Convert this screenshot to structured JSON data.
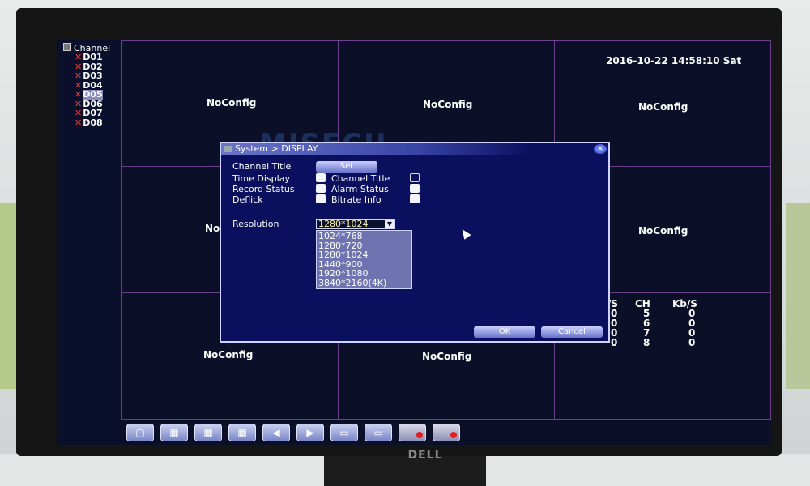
{
  "sidebar": {
    "header": "Channel",
    "items": [
      {
        "label": "D01",
        "selected": false
      },
      {
        "label": "D02",
        "selected": false
      },
      {
        "label": "D03",
        "selected": false
      },
      {
        "label": "D04",
        "selected": false
      },
      {
        "label": "D05",
        "selected": true
      },
      {
        "label": "D06",
        "selected": false
      },
      {
        "label": "D07",
        "selected": false
      },
      {
        "label": "D08",
        "selected": false
      }
    ]
  },
  "grid": {
    "noconfig_label": "NoConfig",
    "datetime": "2016-10-22 14:58:10 Sat",
    "partial_label": "No"
  },
  "stats": {
    "headers": [
      "/S",
      "CH",
      "Kb/S"
    ],
    "rows": [
      [
        "0",
        "5",
        "0"
      ],
      [
        "0",
        "6",
        "0"
      ],
      [
        "0",
        "7",
        "0"
      ],
      [
        "0",
        "8",
        "0"
      ]
    ]
  },
  "dialog": {
    "title": "System > DISPLAY",
    "close_icon": "close-icon",
    "channel_title_label": "Channel Title",
    "set_button": "Set",
    "time_display_label": "Time Display",
    "channel_title2_label": "Channel Title",
    "record_status_label": "Record Status",
    "alarm_status_label": "Alarm Status",
    "deflick_label": "Deflick",
    "bitrate_info_label": "Bitrate Info",
    "resolution_label": "Resolution",
    "resolution_value": "1280*1024",
    "resolution_options": [
      "1024*768",
      "1280*720",
      "1280*1024",
      "1440*900",
      "1920*1080",
      "3840*2160(4K)"
    ],
    "ok_button": "OK",
    "cancel_button": "Cancel"
  },
  "taskbar": {
    "icons": [
      "single-view-icon",
      "quad-view-icon",
      "nine-view-icon",
      "sixteen-view-icon",
      "previous-icon",
      "next-icon",
      "playback-icon",
      "search-icon",
      "record-icon",
      "alarm-record-icon"
    ]
  },
  "monitor": {
    "brand": "DELL",
    "watermark": "MISECU"
  },
  "colors": {
    "screen_bg": "#0c1230",
    "dialog_bg": "#0a0f5e",
    "grid_border": "#6a3f8c",
    "record_red": "#e02020"
  }
}
